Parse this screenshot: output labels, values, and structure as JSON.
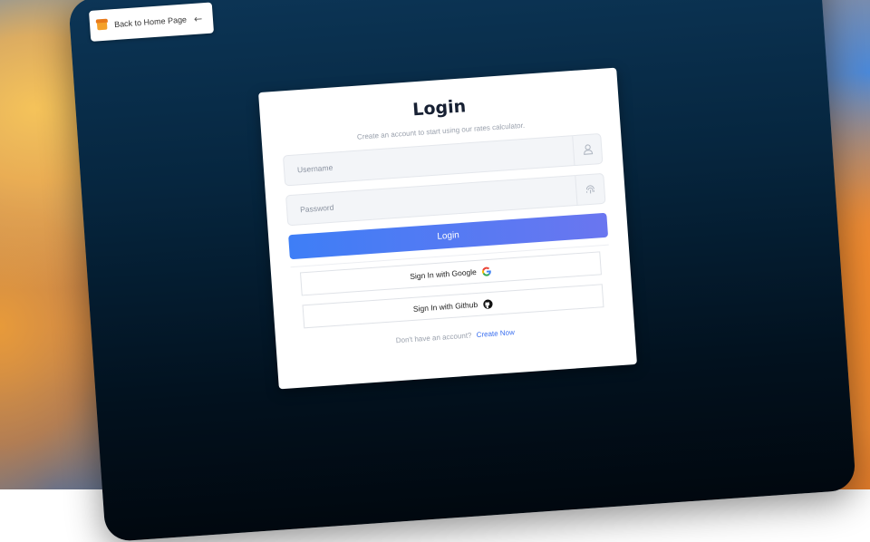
{
  "back_button": {
    "label": "Back to Home Page",
    "icon": "home-icon",
    "arrow_icon": "arrow-left-icon"
  },
  "login_card": {
    "title": "Login",
    "subtitle": "Create an account to start using our rates calculator.",
    "username": {
      "placeholder": "Username",
      "value": "",
      "icon": "user-icon"
    },
    "password": {
      "placeholder": "Password",
      "value": "",
      "icon": "fingerprint-icon"
    },
    "login_button": "Login",
    "google_button": "Sign In with Google",
    "github_button": "Sign In with Github",
    "footer_text": "Don't have an account?",
    "footer_link": "Create Now"
  },
  "colors": {
    "accent_start": "#3e7ef6",
    "accent_end": "#6a76f0",
    "link": "#3a6ff0",
    "panel_bg": "#06263f"
  }
}
